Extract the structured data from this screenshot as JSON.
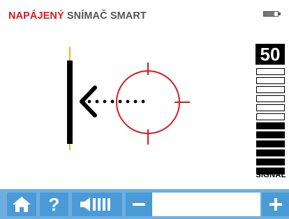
{
  "header": {
    "title_accent": "NAPÁJENÝ",
    "title_rest": "SNÍMAČ SMART",
    "battery_icon": "battery-icon",
    "battery_level": 0.75
  },
  "signal": {
    "value": "50",
    "label": "SIGNAL",
    "segments_total": 12,
    "segments_filled": 6
  },
  "graphic": {
    "target_icon": "crosshair-target-icon",
    "direction_icon": "chevron-left-arrow-icon"
  },
  "toolbar": {
    "home_icon": "home-icon",
    "help_label": "?",
    "volume_icon": "volume-icon",
    "minus_icon": "minus-icon",
    "plus_icon": "plus-icon",
    "field_value": ""
  },
  "colors": {
    "accent": "#d7191f",
    "toolbar": "#6dafe0",
    "button": "#4a9ad6",
    "stud_tick": "#f2b41c"
  }
}
